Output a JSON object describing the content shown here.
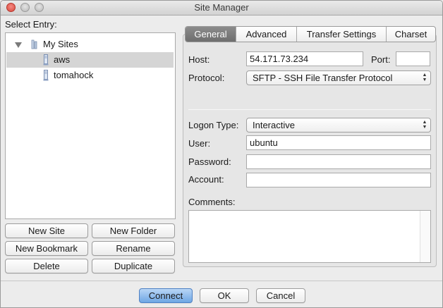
{
  "window": {
    "title": "Site Manager"
  },
  "tree": {
    "label": "Select Entry:",
    "root": {
      "label": "My Sites",
      "expanded": true
    },
    "items": [
      {
        "label": "aws",
        "selected": true
      },
      {
        "label": "tomahock",
        "selected": false
      }
    ]
  },
  "left_buttons": {
    "new_site": "New Site",
    "new_folder": "New Folder",
    "new_bookmark": "New Bookmark",
    "rename": "Rename",
    "delete": "Delete",
    "duplicate": "Duplicate"
  },
  "tabs": [
    {
      "label": "General",
      "active": true
    },
    {
      "label": "Advanced",
      "active": false
    },
    {
      "label": "Transfer Settings",
      "active": false
    },
    {
      "label": "Charset",
      "active": false
    }
  ],
  "general": {
    "host_label": "Host:",
    "host_value": "54.171.73.234",
    "port_label": "Port:",
    "port_value": "",
    "protocol_label": "Protocol:",
    "protocol_value": "SFTP - SSH File Transfer Protocol",
    "logon_type_label": "Logon Type:",
    "logon_type_value": "Interactive",
    "user_label": "User:",
    "user_value": "ubuntu",
    "password_label": "Password:",
    "password_value": "",
    "account_label": "Account:",
    "account_value": "",
    "comments_label": "Comments:",
    "comments_value": ""
  },
  "footer": {
    "connect": "Connect",
    "ok": "OK",
    "cancel": "Cancel"
  },
  "colors": {
    "active_tab": "#7c7c7c",
    "primary_button": "#8fbcee",
    "selection": "#d5d5d5",
    "close_button": "#e0574c"
  }
}
